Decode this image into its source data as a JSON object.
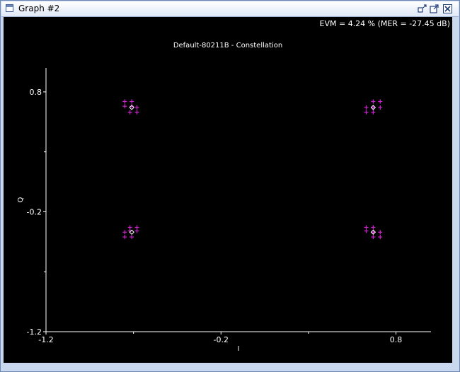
{
  "window": {
    "title": "Graph #2",
    "buttons": [
      "restore-icon",
      "maximize-icon",
      "close-icon"
    ]
  },
  "evm_text": "EVM = 4.24 % (MER = -27.45 dB)",
  "chart_data": {
    "type": "scatter",
    "title": "Default-80211B - Constellation",
    "xlabel": "I",
    "ylabel": "Q",
    "xlim": [
      -1.2,
      1.0
    ],
    "ylim": [
      -1.2,
      1.0
    ],
    "xticks": [
      "-1.2",
      "-0.2",
      "0.8"
    ],
    "yticks": [
      "0.8",
      "-0.2",
      "-1.2"
    ],
    "xtick_values": [
      -1.2,
      -0.2,
      0.8
    ],
    "ytick_values": [
      0.8,
      -0.2,
      -1.2
    ],
    "minor_tick_values": [
      -0.7,
      0.3
    ],
    "colors": {
      "samples": "#cc22cc",
      "reference": "#ffffff",
      "axes": "#ffffff"
    },
    "series": [
      {
        "marker": "+",
        "points": [
          [
            -0.75,
            0.72
          ],
          [
            -0.71,
            0.72
          ],
          [
            -0.75,
            0.68
          ],
          [
            -0.71,
            0.68
          ],
          [
            -0.68,
            0.67
          ],
          [
            -0.68,
            0.63
          ],
          [
            -0.72,
            0.63
          ],
          [
            0.67,
            0.72
          ],
          [
            0.71,
            0.72
          ],
          [
            0.63,
            0.67
          ],
          [
            0.67,
            0.67
          ],
          [
            0.71,
            0.67
          ],
          [
            0.63,
            0.63
          ],
          [
            0.67,
            0.63
          ],
          [
            -0.72,
            -0.33
          ],
          [
            -0.68,
            -0.33
          ],
          [
            -0.72,
            -0.36
          ],
          [
            -0.68,
            -0.36
          ],
          [
            -0.75,
            -0.37
          ],
          [
            -0.75,
            -0.41
          ],
          [
            -0.71,
            -0.41
          ],
          [
            0.63,
            -0.33
          ],
          [
            0.67,
            -0.33
          ],
          [
            0.63,
            -0.36
          ],
          [
            0.67,
            -0.37
          ],
          [
            0.71,
            -0.37
          ],
          [
            0.67,
            -0.41
          ],
          [
            0.71,
            -0.41
          ]
        ]
      },
      {
        "marker": "diamond",
        "points": [
          [
            -0.71,
            0.67
          ],
          [
            0.67,
            0.67
          ],
          [
            -0.71,
            -0.37
          ],
          [
            0.67,
            -0.37
          ]
        ]
      }
    ]
  }
}
